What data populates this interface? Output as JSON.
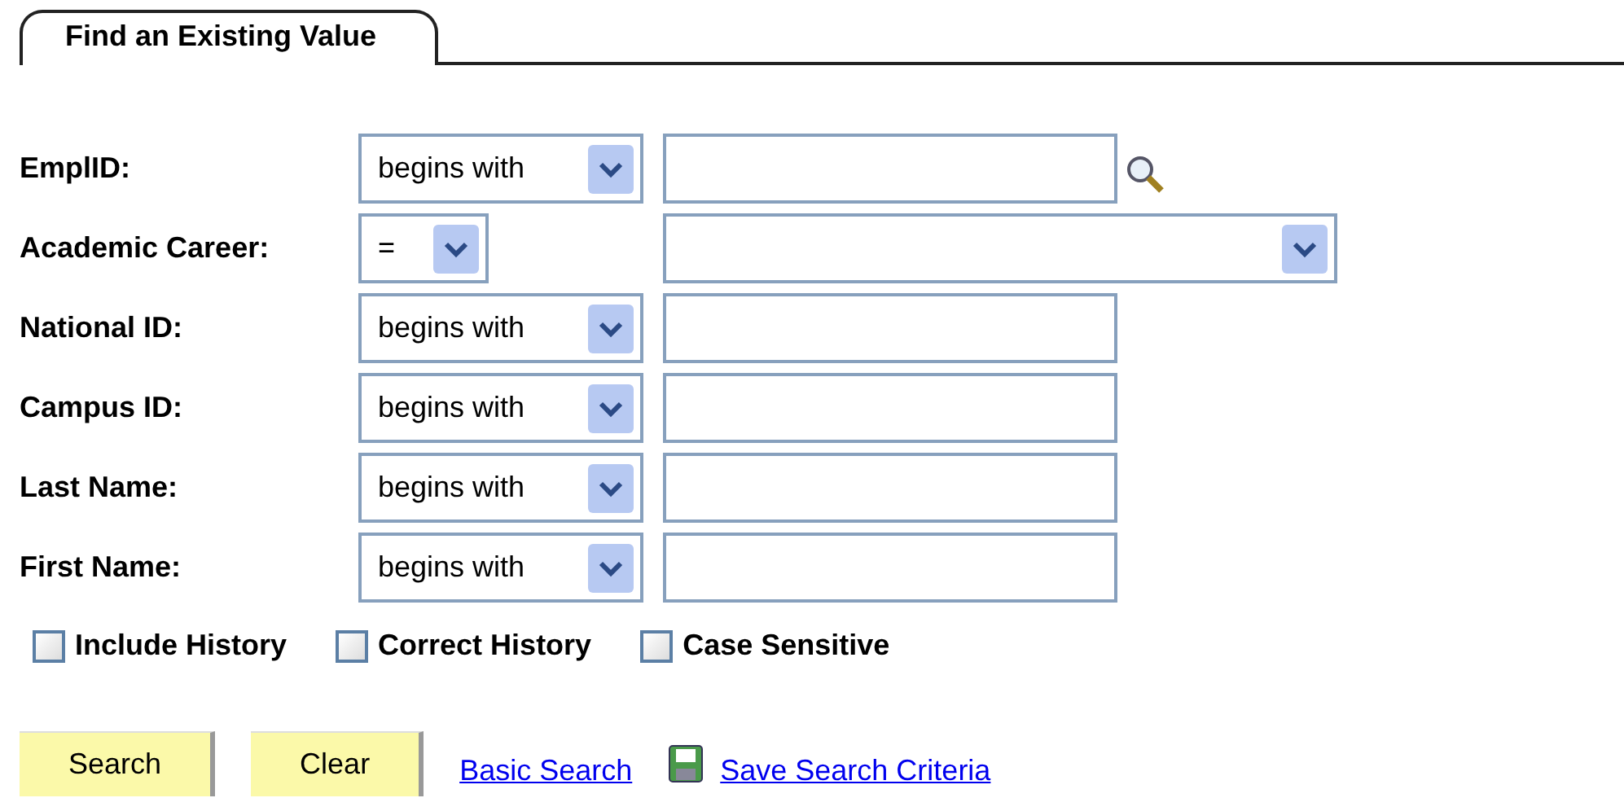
{
  "tab": {
    "label": "Find an Existing Value",
    "selected": true
  },
  "fields": [
    {
      "kind": "text",
      "label": "EmplID:",
      "operator": "begins with",
      "lookup": true
    },
    {
      "kind": "select",
      "label": "Academic Career:",
      "operator": "="
    },
    {
      "kind": "text",
      "label": "National ID:",
      "operator": "begins with",
      "lookup": false
    },
    {
      "kind": "text",
      "label": "Campus ID:",
      "operator": "begins with",
      "lookup": false
    },
    {
      "kind": "text",
      "label": "Last Name:",
      "operator": "begins with",
      "lookup": false
    },
    {
      "kind": "text",
      "label": "First Name:",
      "operator": "begins with",
      "lookup": false
    }
  ],
  "options": [
    {
      "label": "Include History",
      "checked": false
    },
    {
      "label": "Correct History",
      "checked": false
    },
    {
      "label": "Case Sensitive",
      "checked": false
    }
  ],
  "buttons": [
    "Search",
    "Clear"
  ],
  "links": [
    {
      "label": "Basic Search",
      "icon": false
    },
    {
      "label": "Save Search Criteria",
      "icon": true
    }
  ]
}
